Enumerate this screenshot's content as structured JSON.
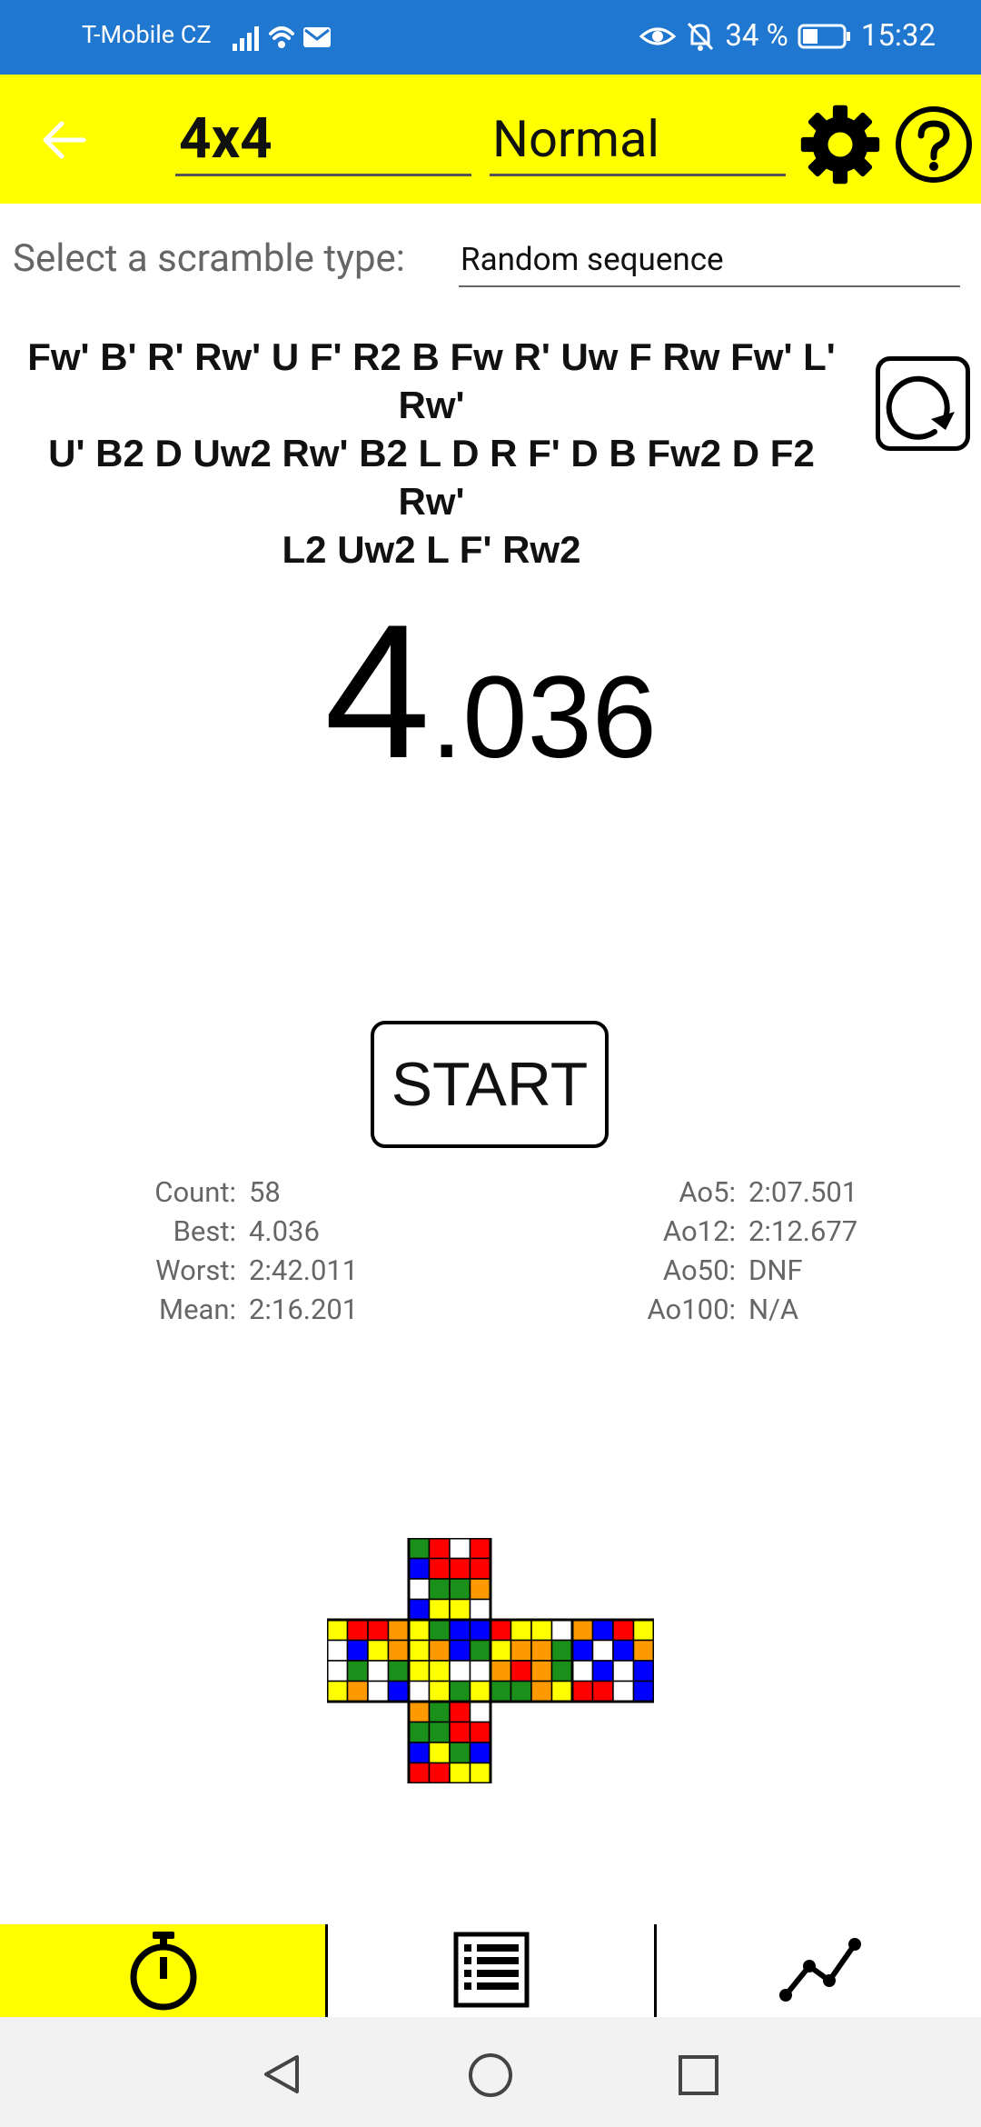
{
  "status_bar": {
    "carrier": "T-Mobile CZ",
    "battery": "34 %",
    "time": "15:32"
  },
  "toolbar": {
    "puzzle": "4x4",
    "mode": "Normal"
  },
  "scramble_type": {
    "label": "Select a scramble type:",
    "value": "Random sequence"
  },
  "scramble": {
    "line1": "Fw' B' R' Rw' U F' R2 B Fw R' Uw F Rw Fw' L' Rw'",
    "line2": "U' B2 D Uw2 Rw' B2 L D R F' D B Fw2 D F2 Rw'",
    "line3": "L2 Uw2 L F' Rw2"
  },
  "timer": {
    "seconds": "4",
    "fraction": ".036"
  },
  "start_label": "START",
  "stats_left": [
    {
      "label": "Count:",
      "value": "58"
    },
    {
      "label": "Best:",
      "value": "4.036"
    },
    {
      "label": "Worst:",
      "value": "2:42.011"
    },
    {
      "label": "Mean:",
      "value": "2:16.201"
    }
  ],
  "stats_right": [
    {
      "label": "Ao5:",
      "value": "2:07.501"
    },
    {
      "label": "Ao12:",
      "value": "2:12.677"
    },
    {
      "label": "Ao50:",
      "value": "DNF"
    },
    {
      "label": "Ao100:",
      "value": "N/A"
    }
  ],
  "cube_net": {
    "colors": {
      "G": "#1a8f1a",
      "B": "#0000ff",
      "W": "#ffffff",
      "R": "#ff0000",
      "Y": "#ffff00",
      "O": "#ff9900"
    },
    "U": [
      "GRWR",
      "BRRR",
      "WGGO",
      "BYYW"
    ],
    "L": [
      "YRRO",
      "WBYO",
      "WGWG",
      "YOWB"
    ],
    "F": [
      "YGBB",
      "YOBG",
      "YYWW",
      "WYGY"
    ],
    "R": [
      "RYYW",
      "YOOG",
      "OROG",
      "GGOY"
    ],
    "B": [
      "OBRY",
      "BWBO",
      "WBWB",
      "RRWB"
    ],
    "D": [
      "OGRW",
      "GGRR",
      "BYGB",
      "RRYY"
    ]
  },
  "icons": {
    "back": "arrow-left-icon",
    "settings": "gear-icon",
    "help": "help-icon",
    "refresh": "refresh-icon",
    "timer_tab": "stopwatch-icon",
    "list_tab": "list-icon",
    "graph_tab": "line-chart-icon"
  },
  "accent": "#ffff00",
  "status_bar_color": "#1f77d0"
}
